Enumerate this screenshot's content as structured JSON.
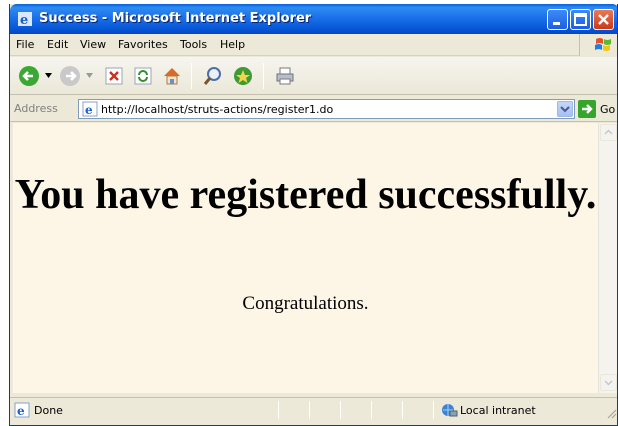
{
  "window": {
    "title": "Success - Microsoft Internet Explorer",
    "title_icon": "ie-icon",
    "buttons": [
      "minimize-icon",
      "maximize-icon",
      "close-icon"
    ]
  },
  "menu": {
    "items": [
      "File",
      "Edit",
      "View",
      "Favorites",
      "Tools",
      "Help"
    ]
  },
  "toolbar": {
    "tools": [
      "back-icon",
      "forward-icon",
      "stop-icon",
      "refresh-icon",
      "home-icon",
      "search-icon",
      "favorites-icon",
      "print-icon"
    ]
  },
  "address": {
    "label": "Address",
    "url": "http://localhost/struts-actions/register1.do",
    "go_label": "Go"
  },
  "page": {
    "heading": "You have registered successfully.",
    "message": "Congratulations."
  },
  "status": {
    "text": "Done",
    "zone": "Local intranet"
  },
  "colors": {
    "titlebar": "#0758d8",
    "page_background": "#fdf5e6",
    "chrome": "#ece9d8"
  }
}
